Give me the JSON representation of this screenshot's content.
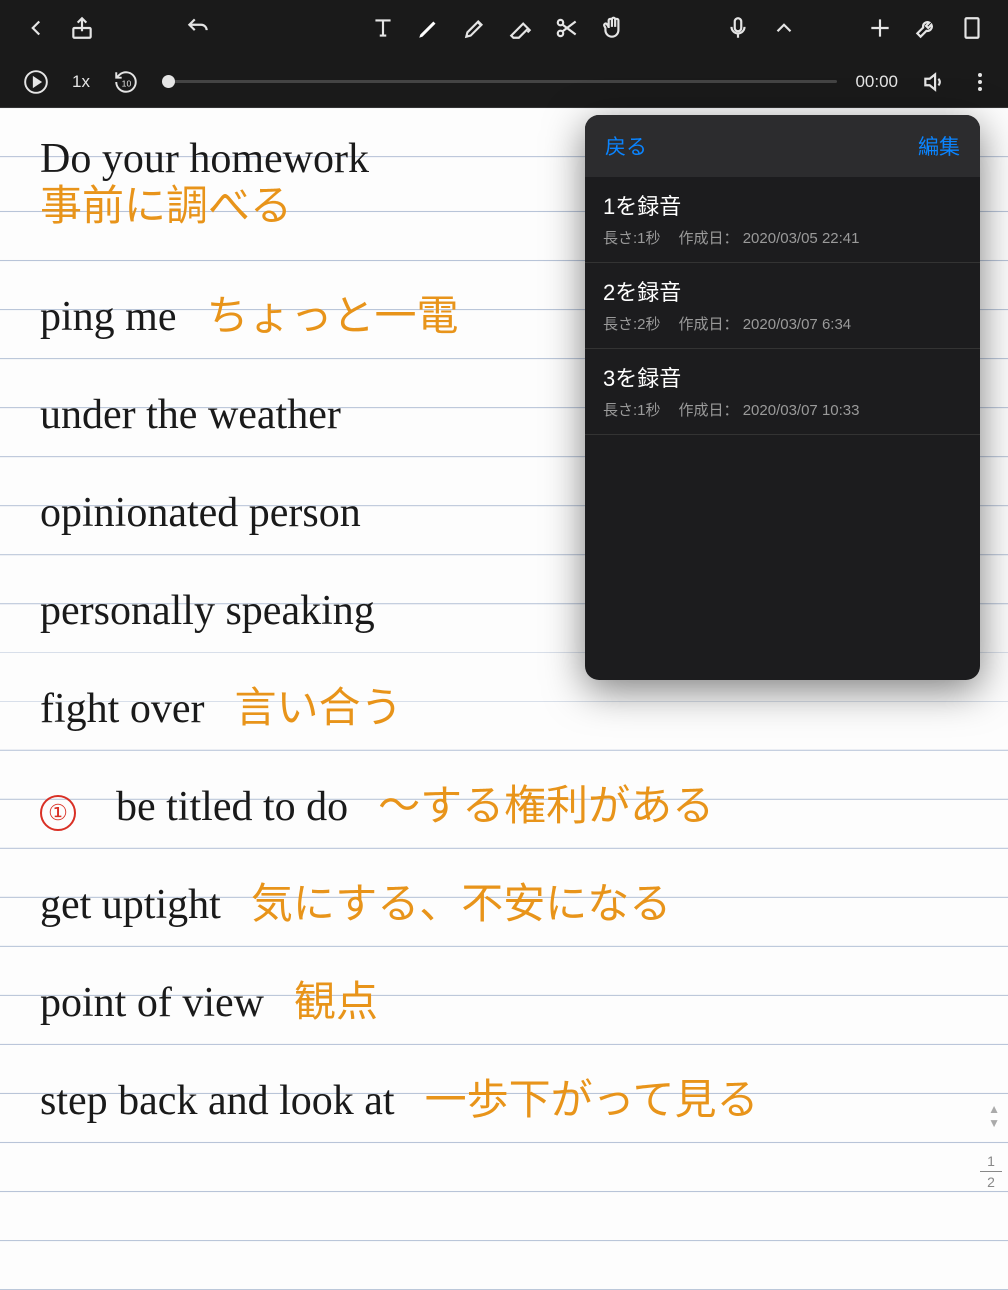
{
  "toolbar": {
    "back": "Back",
    "share": "Share",
    "undo": "Undo",
    "text": "Text",
    "pen": "Pen",
    "highlighter": "Highlighter",
    "eraser": "Eraser",
    "scissors": "Scissors",
    "hand": "Hand",
    "mic": "Microphone",
    "chevron": "Expand",
    "add": "Add",
    "wrench": "Settings",
    "page": "Page"
  },
  "playback": {
    "play": "Play",
    "speed": "1x",
    "rewind": "10",
    "time": "00:00",
    "volume": "Volume",
    "more": "More"
  },
  "notes": {
    "line1_en": "Do your homework",
    "line1_jp": "事前に調べる",
    "line2_en": "ping me",
    "line2_jp": "ちょっと一電",
    "line3_en": "under the weather",
    "line4_en": "opinionated person",
    "line5_en": "personally speaking",
    "line6_en": "fight over",
    "line6_jp": "言い合う",
    "line7_en": "be titled to do",
    "line7_jp": "〜する権利がある",
    "line7_mark": "①",
    "line8_en": "get uptight",
    "line8_jp": "気にする、不安になる",
    "line9_en": "point of view",
    "line9_jp": "観点",
    "line10_en": "step back and look at",
    "line10_jp": "一歩下がって見る"
  },
  "popover": {
    "back": "戻る",
    "edit": "編集",
    "recordings": [
      {
        "title": "1を録音",
        "length": "長さ:1秒",
        "created_label": "作成日：",
        "created": "2020/03/05 22:41"
      },
      {
        "title": "2を録音",
        "length": "長さ:2秒",
        "created_label": "作成日：",
        "created": "2020/03/07 6:34"
      },
      {
        "title": "3を録音",
        "length": "長さ:1秒",
        "created_label": "作成日：",
        "created": "2020/03/07 10:33"
      }
    ]
  },
  "page": {
    "current": "1",
    "total": "2"
  }
}
